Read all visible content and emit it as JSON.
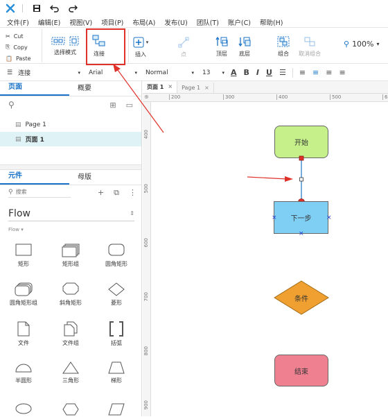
{
  "title_bar": {
    "icons": [
      "logo-icon",
      "save-icon",
      "undo-icon",
      "redo-icon"
    ]
  },
  "menu": [
    "文件(F)",
    "编辑(E)",
    "视图(V)",
    "项目(P)",
    "布局(A)",
    "发布(U)",
    "团队(T)",
    "账户(C)",
    "帮助(H)"
  ],
  "clipboard": {
    "cut": "Cut",
    "copy": "Copy",
    "paste": "Paste"
  },
  "ribbon": {
    "select_mode": "选择模式",
    "connect": "连接",
    "insert": "插入",
    "point": "点",
    "top": "顶层",
    "bottom": "底层",
    "group": "组合",
    "ungroup": "取消组合",
    "zoom": "100%"
  },
  "format": {
    "connector": "连接",
    "font": "Arial",
    "style": "Normal",
    "size": "13"
  },
  "pages_panel": {
    "tab_pages": "页面",
    "tab_outline": "概要",
    "pages": [
      "Page 1",
      "页面 1"
    ]
  },
  "widgets_panel": {
    "tab_widgets": "元件",
    "tab_masters": "母版",
    "search_placeholder": "搜索",
    "library": "Flow",
    "section": "Flow ▾",
    "items": [
      "矩形",
      "矩形组",
      "圆角矩形",
      "圆角矩形组",
      "斜角矩形",
      "菱形",
      "文件",
      "文件组",
      "括弧",
      "半圆形",
      "三角形",
      "梯形"
    ]
  },
  "canvas": {
    "tabs": [
      "页面 1",
      "Page 1"
    ],
    "ruler_h": [
      "200",
      "300",
      "400",
      "500",
      "6"
    ],
    "ruler_v": [
      "400",
      "500",
      "600",
      "700",
      "800",
      "900"
    ],
    "shapes": {
      "start": "开始",
      "next": "下一步",
      "condition": "条件",
      "end": "结束"
    }
  },
  "colors": {
    "accent": "#1a73c8",
    "start": "#c5f08a",
    "next": "#7fcff5",
    "condition": "#f0a030",
    "end": "#ef8090",
    "highlight": "#e0302a"
  }
}
